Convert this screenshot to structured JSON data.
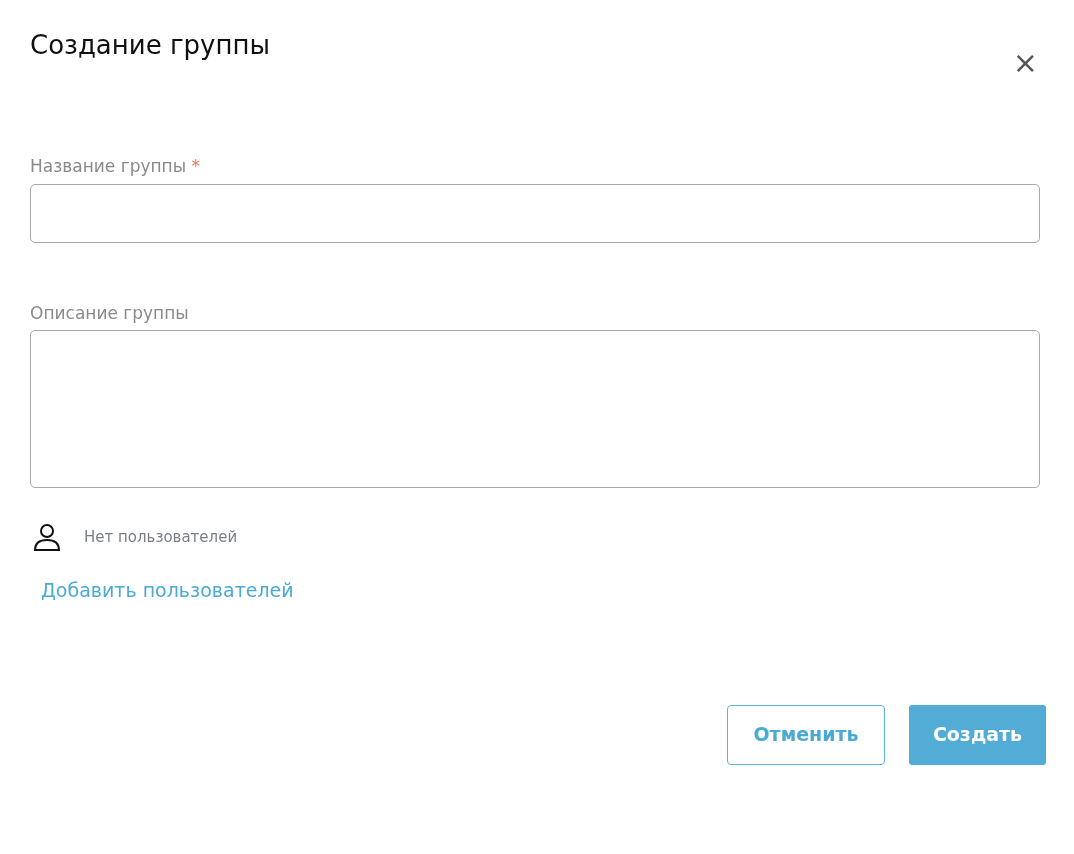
{
  "dialog": {
    "title": "Создание группы",
    "close": "×"
  },
  "fields": [
    {
      "kind": "input",
      "label": "Название группы",
      "required": true,
      "required_mark": "*"
    },
    {
      "kind": "textarea",
      "label": "Описание группы"
    }
  ],
  "users": {
    "empty_text": "Нет пользователей",
    "add_link": "Добавить пользователей"
  },
  "buttons": [
    {
      "kind": "outline",
      "label": "Отменить"
    },
    {
      "kind": "primary",
      "label": "Создать"
    }
  ]
}
